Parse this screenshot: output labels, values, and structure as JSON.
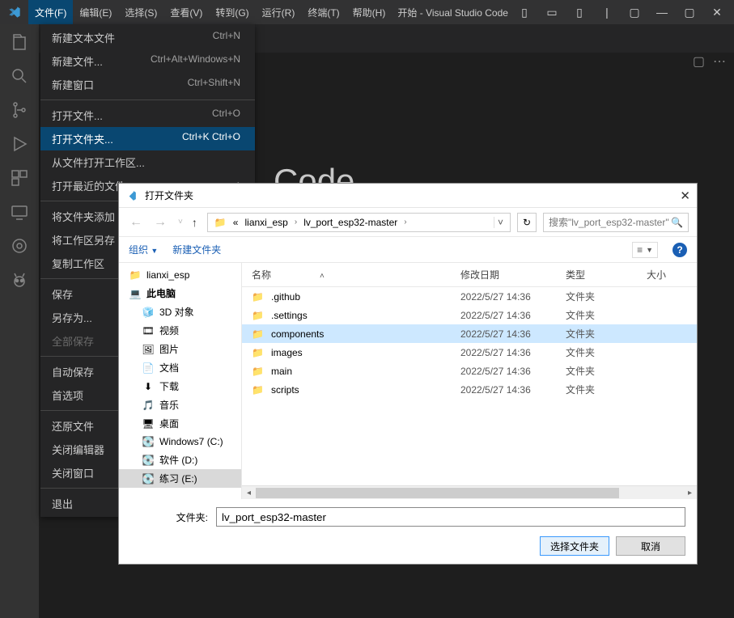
{
  "titlebar": {
    "title": "开始 - Visual Studio Code"
  },
  "menubar": [
    "文件(F)",
    "编辑(E)",
    "选择(S)",
    "查看(V)",
    "转到(G)",
    "运行(R)",
    "终端(T)",
    "帮助(H)"
  ],
  "editor": {
    "welcome_word": "Code"
  },
  "file_menu": {
    "groups": [
      [
        {
          "label": "新建文本文件",
          "shortcut": "Ctrl+N"
        },
        {
          "label": "新建文件...",
          "shortcut": "Ctrl+Alt+Windows+N"
        },
        {
          "label": "新建窗口",
          "shortcut": "Ctrl+Shift+N"
        }
      ],
      [
        {
          "label": "打开文件...",
          "shortcut": "Ctrl+O"
        },
        {
          "label": "打开文件夹...",
          "shortcut": "Ctrl+K Ctrl+O",
          "highlighted": true
        },
        {
          "label": "从文件打开工作区..."
        },
        {
          "label": "打开最近的文件",
          "submenu": true
        }
      ],
      [
        {
          "label": "将文件夹添加"
        },
        {
          "label": "将工作区另存"
        },
        {
          "label": "复制工作区"
        }
      ],
      [
        {
          "label": "保存"
        },
        {
          "label": "另存为..."
        },
        {
          "label": "全部保存",
          "disabled": true
        }
      ],
      [
        {
          "label": "自动保存"
        },
        {
          "label": "首选项",
          "submenu": true
        }
      ],
      [
        {
          "label": "还原文件"
        },
        {
          "label": "关闭编辑器"
        },
        {
          "label": "关闭窗口"
        }
      ],
      [
        {
          "label": "退出"
        }
      ]
    ]
  },
  "dialog": {
    "title": "打开文件夹",
    "breadcrumb": [
      "«",
      "lianxi_esp",
      "lv_port_esp32-master"
    ],
    "search_placeholder": "搜索\"lv_port_esp32-master\"",
    "toolbar": {
      "organize": "组织",
      "newfolder": "新建文件夹"
    },
    "tree": [
      {
        "icon": "folder",
        "label": "lianxi_esp",
        "indent": false
      },
      {
        "icon": "pc",
        "label": "此电脑",
        "indent": false,
        "bold": true
      },
      {
        "icon": "3d",
        "label": "3D 对象",
        "indent": true
      },
      {
        "icon": "video",
        "label": "视频",
        "indent": true
      },
      {
        "icon": "image",
        "label": "图片",
        "indent": true
      },
      {
        "icon": "doc",
        "label": "文档",
        "indent": true
      },
      {
        "icon": "download",
        "label": "下载",
        "indent": true
      },
      {
        "icon": "music",
        "label": "音乐",
        "indent": true
      },
      {
        "icon": "desktop",
        "label": "桌面",
        "indent": true
      },
      {
        "icon": "drive",
        "label": "Windows7 (C:)",
        "indent": true
      },
      {
        "icon": "drive",
        "label": "软件 (D:)",
        "indent": true
      },
      {
        "icon": "drive",
        "label": "练习 (E:)",
        "indent": true,
        "selected": true
      }
    ],
    "columns": {
      "name": "名称",
      "date": "修改日期",
      "type": "类型",
      "size": "大小"
    },
    "rows": [
      {
        "name": ".github",
        "date": "2022/5/27 14:36",
        "type": "文件夹"
      },
      {
        "name": ".settings",
        "date": "2022/5/27 14:36",
        "type": "文件夹"
      },
      {
        "name": "components",
        "date": "2022/5/27 14:36",
        "type": "文件夹",
        "selected": true
      },
      {
        "name": "images",
        "date": "2022/5/27 14:36",
        "type": "文件夹"
      },
      {
        "name": "main",
        "date": "2022/5/27 14:36",
        "type": "文件夹"
      },
      {
        "name": "scripts",
        "date": "2022/5/27 14:36",
        "type": "文件夹"
      }
    ],
    "input_label": "文件夹:",
    "input_value": "lv_port_esp32-master",
    "btn_primary": "选择文件夹",
    "btn_cancel": "取消"
  }
}
